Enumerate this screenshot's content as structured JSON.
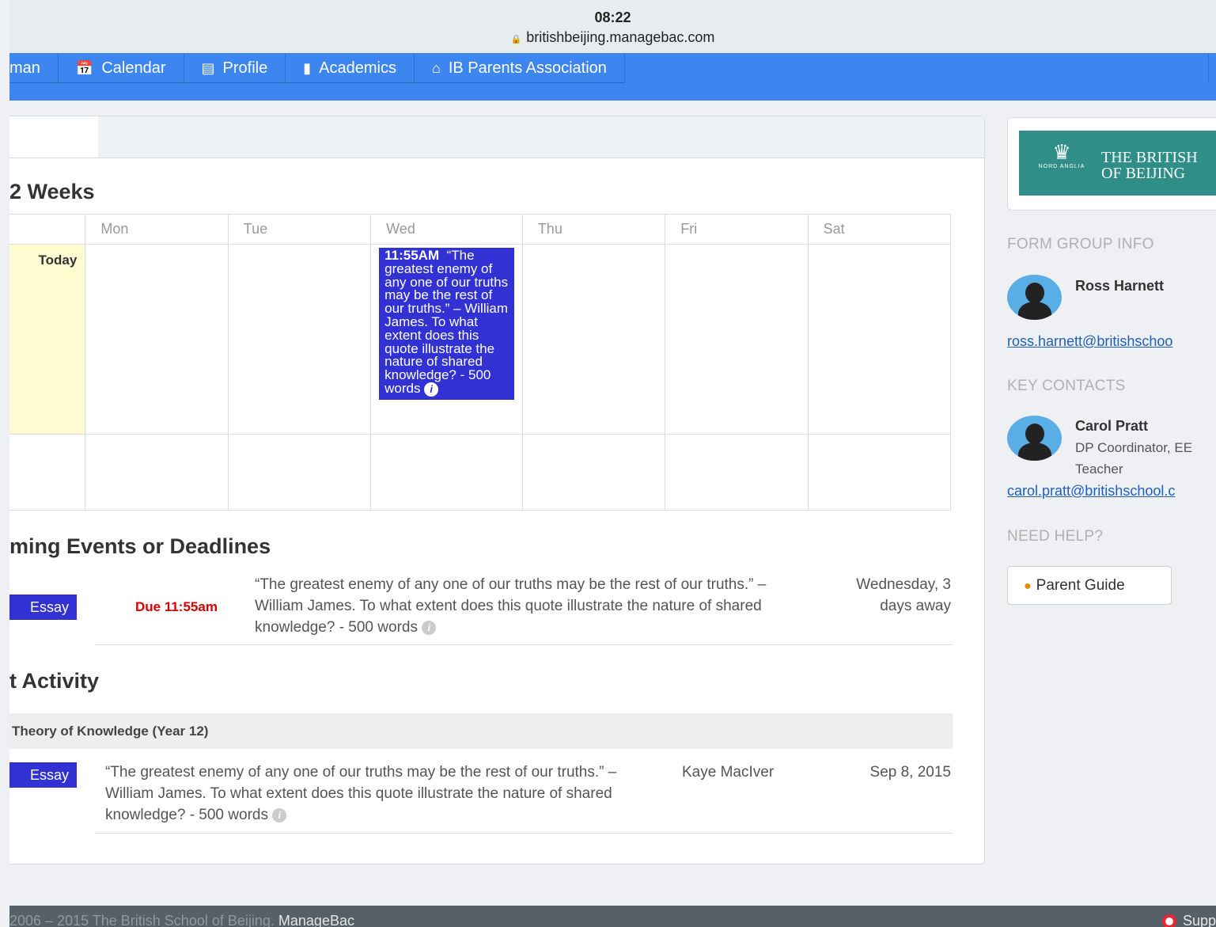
{
  "status_bar": {
    "time": "08:22",
    "url": "britishbeijing.managebac.com"
  },
  "nav": {
    "items": [
      {
        "label": "man"
      },
      {
        "label": "Calendar",
        "icon": "calendar-icon"
      },
      {
        "label": "Profile",
        "icon": "profile-card-icon"
      },
      {
        "label": "Academics",
        "icon": "book-icon"
      },
      {
        "label": "IB Parents Association",
        "icon": "home-icon"
      }
    ]
  },
  "calendar": {
    "title": "2 Weeks",
    "days": [
      "Mon",
      "Tue",
      "Wed",
      "Thu",
      "Fri",
      "Sat"
    ],
    "today_label": "Today",
    "event": {
      "time": "11:55AM",
      "text": "“The greatest enemy of any one of our truths may be the rest of our truths.” – William James. To what extent does this quote illustrate the nature of shared knowledge? - 500 words"
    }
  },
  "upcoming": {
    "title": "ming Events or Deadlines",
    "items": [
      {
        "badge": "Essay",
        "due": "Due 11:55am",
        "text": "“The greatest enemy of any one of our truths may be the rest of our truths.” – William James. To what extent does this quote illustrate the nature of shared knowledge? - 500 words",
        "when": "Wednesday, 3 days away"
      }
    ]
  },
  "activity": {
    "title": "t Activity",
    "group": "Theory of Knowledge (Year 12)",
    "items": [
      {
        "badge": "Essay",
        "text": "“The greatest enemy of any one of our truths may be the rest of our truths.” – William James. To what extent does this quote illustrate the nature of shared knowledge? - 500 words",
        "author": "Kaye MacIver",
        "date": "Sep 8, 2015"
      }
    ]
  },
  "sidebar": {
    "logo": {
      "line1": "THE BRITISH",
      "line2": "OF BEIJING",
      "crest_text": "NORD ANGLIA"
    },
    "form_group_heading": "FORM GROUP INFO",
    "form_tutor": {
      "name": "Ross Harnett",
      "email": "ross.harnett@britishschoo"
    },
    "key_contacts_heading": "KEY CONTACTS",
    "contact": {
      "name": "Carol Pratt",
      "role_line1": "DP Coordinator, EE",
      "role_line2": "Teacher",
      "email": "carol.pratt@britishschool.c"
    },
    "help_heading": "NEED HELP?",
    "guide_button": "Parent Guide"
  },
  "footer": {
    "copyright": "2006 – 2015 The British School of Beijing.",
    "brand": "ManageBac",
    "support": "Supp"
  },
  "colors": {
    "nav": "#3d86f0",
    "badge": "#3131d4",
    "today": "#fffbd0",
    "due": "#d40000",
    "footer": "#556068"
  }
}
